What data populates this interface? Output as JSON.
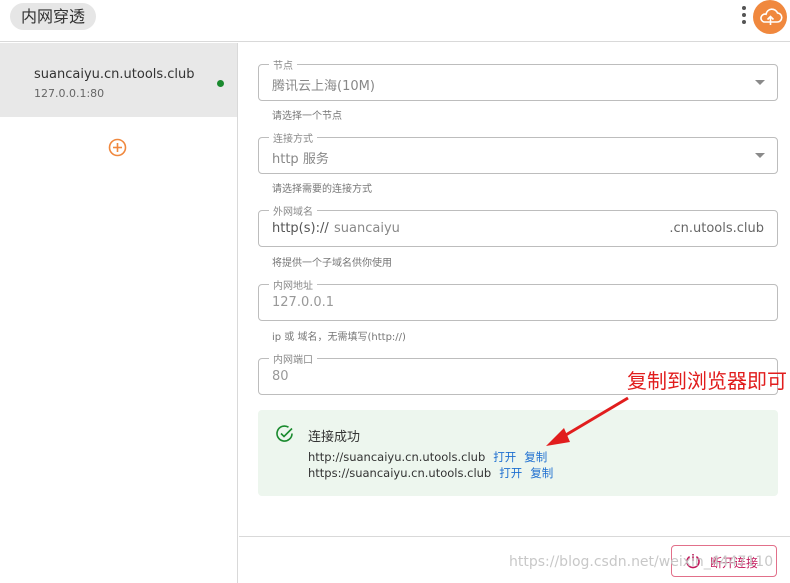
{
  "app": {
    "title": "内网穿透"
  },
  "sidebar": {
    "items": [
      {
        "domain": "suancaiyu.cn.utools.club",
        "address": "127.0.0.1:80",
        "status": "connected"
      }
    ]
  },
  "form": {
    "node": {
      "legend": "节点",
      "value": "腾讯云上海(10M)",
      "hint": "请选择一个节点"
    },
    "method": {
      "legend": "连接方式",
      "value": "http 服务",
      "hint": "请选择需要的连接方式"
    },
    "domain": {
      "legend": "外网域名",
      "prefix": "http(s)://",
      "value": "suancaiyu",
      "suffix": ".cn.utools.club",
      "hint": "将提供一个子域名供你使用"
    },
    "local_addr": {
      "legend": "内网地址",
      "placeholder": "127.0.0.1",
      "hint": "ip 或 域名，无需填写(http://)"
    },
    "local_port": {
      "legend": "内网端口",
      "placeholder": "80"
    }
  },
  "status": {
    "title": "连接成功",
    "urls": [
      {
        "url": "http://suancaiyu.cn.utools.club",
        "open": "打开",
        "copy": "复制"
      },
      {
        "url": "https://suancaiyu.cn.utools.club",
        "open": "打开",
        "copy": "复制"
      }
    ]
  },
  "footer": {
    "disconnect_label": "断开连接"
  },
  "annotation": {
    "text": "复制到浏览器即可"
  },
  "watermark": {
    "text": "https://blog.csdn.net/weixin_4447110"
  },
  "colors": {
    "accent": "#f0883e",
    "success": "#1a8a2e",
    "link": "#1e6fd0",
    "danger": "#c2185b",
    "annotation": "#e11d1d"
  },
  "icons": {
    "more": "more-vert-icon",
    "cloud": "cloud-upload-icon",
    "add": "add-circle-icon",
    "check": "check-circle-icon",
    "power": "power-icon"
  }
}
